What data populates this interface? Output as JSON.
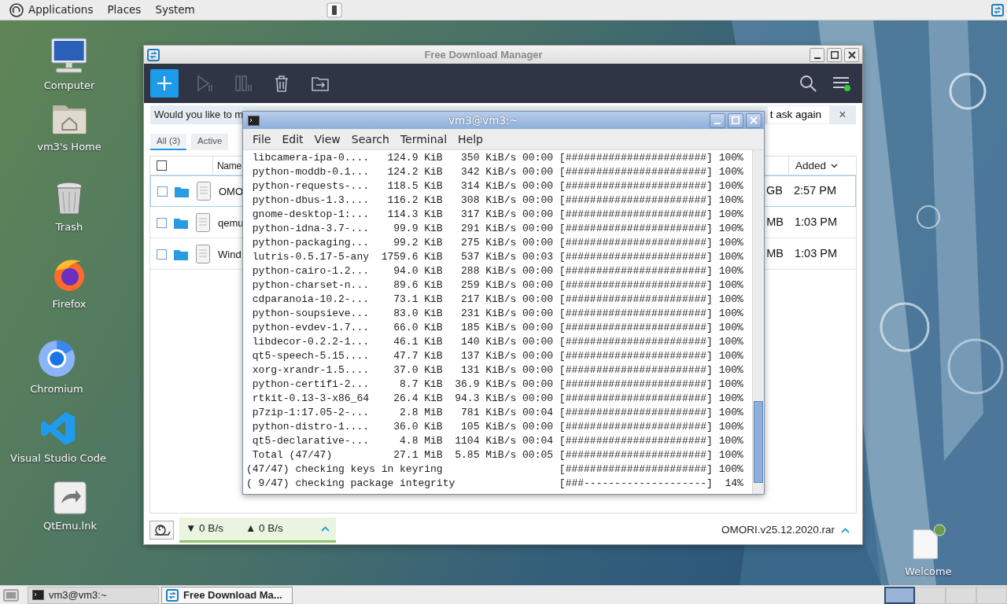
{
  "top_panel": {
    "menus": [
      "Applications",
      "Places",
      "System"
    ]
  },
  "desktop_icons": [
    {
      "label": "Computer",
      "kind": "computer"
    },
    {
      "label": "vm3's Home",
      "kind": "home"
    },
    {
      "label": "Trash",
      "kind": "trash"
    },
    {
      "label": "Firefox",
      "kind": "fox"
    },
    {
      "label": "Chromium",
      "kind": "chromium"
    },
    {
      "label": "Visual Studio Code",
      "kind": "code"
    },
    {
      "label": "QtEmu.lnk",
      "kind": "shortcut"
    },
    {
      "label": "Welcome",
      "kind": "document"
    }
  ],
  "download_window": {
    "title": "Free Download Manager",
    "toolbar": [
      {
        "kind": "add",
        "disabled": false
      },
      {
        "kind": "start",
        "disabled": true
      },
      {
        "kind": "stop",
        "disabled": true
      },
      {
        "kind": "delete",
        "disabled": false
      },
      {
        "kind": "move",
        "disabled": false
      },
      {
        "kind": "search",
        "disabled": false
      },
      {
        "kind": "menu",
        "disabled": false
      }
    ],
    "notice": {
      "text": "Would you like to m",
      "button": "t ask again",
      "close": "×"
    },
    "filters": [
      {
        "label": "All (3)",
        "selected": true
      },
      {
        "label": "Active",
        "selected": false
      }
    ],
    "select_all": {
      "checked": false
    },
    "columns": [
      {
        "label": "Name",
        "sorted": false
      },
      {
        "label": "Added",
        "sorted": true
      }
    ],
    "rows": [
      {
        "name": "OMO",
        "size": "GB",
        "added": "2:57 PM",
        "checked": false,
        "selected": true
      },
      {
        "name": "qemu",
        "size": "MB",
        "added": "1:03 PM",
        "checked": false,
        "selected": false
      },
      {
        "name": "Wind",
        "size": "MB",
        "added": "1:03 PM",
        "checked": false,
        "selected": false
      }
    ],
    "status": {
      "download": "▼ 0 B/s",
      "upload": "▲ 0 B/s",
      "file": "OMORI.v25.12.2020.rar"
    }
  },
  "terminal": {
    "title": "vm3@vm3:~",
    "menu": [
      "File",
      "Edit",
      "View",
      "Search",
      "Terminal",
      "Help"
    ],
    "lines": [
      " libcamera-ipa-0....   124.9 KiB   350 KiB/s 00:00 [#######################] 100%",
      " python-moddb-0.1...   124.2 KiB   342 KiB/s 00:00 [#######################] 100%",
      " python-requests-...   118.5 KiB   314 KiB/s 00:00 [#######################] 100%",
      " python-dbus-1.3....   116.2 KiB   308 KiB/s 00:00 [#######################] 100%",
      " gnome-desktop-1:...   114.3 KiB   317 KiB/s 00:00 [#######################] 100%",
      " python-idna-3.7-...    99.9 KiB   291 KiB/s 00:00 [#######################] 100%",
      " python-packaging...    99.2 KiB   275 KiB/s 00:00 [#######################] 100%",
      " lutris-0.5.17-5-any  1759.6 KiB   537 KiB/s 00:03 [#######################] 100%",
      " python-cairo-1.2...    94.0 KiB   288 KiB/s 00:00 [#######################] 100%",
      " python-charset-n...    89.6 KiB   259 KiB/s 00:00 [#######################] 100%",
      " cdparanoia-10.2-...    73.1 KiB   217 KiB/s 00:00 [#######################] 100%",
      " python-soupsieve...    83.0 KiB   231 KiB/s 00:00 [#######################] 100%",
      " python-evdev-1.7...    66.0 KiB   185 KiB/s 00:00 [#######################] 100%",
      " libdecor-0.2.2-1...    46.1 KiB   140 KiB/s 00:00 [#######################] 100%",
      " qt5-speech-5.15....    47.7 KiB   137 KiB/s 00:00 [#######################] 100%",
      " xorg-xrandr-1.5....    37.0 KiB   131 KiB/s 00:00 [#######################] 100%",
      " python-certifi-2...     8.7 KiB  36.9 KiB/s 00:00 [#######################] 100%",
      " rtkit-0.13-3-x86_64    26.4 KiB  94.3 KiB/s 00:00 [#######################] 100%",
      " p7zip-1:17.05-2-...     2.8 MiB   781 KiB/s 00:04 [#######################] 100%",
      " python-distro-1....    36.0 KiB   105 KiB/s 00:00 [#######################] 100%",
      " qt5-declarative-...     4.8 MiB  1104 KiB/s 00:04 [#######################] 100%",
      " Total (47/47)          27.1 MiB  5.85 MiB/s 00:05 [#######################] 100%",
      "(47/47) checking keys in keyring                   [#######################] 100%",
      "( 9/47) checking package integrity                 [###--------------------]  14%"
    ]
  },
  "taskbar": {
    "tasks": [
      {
        "label": "vm3@vm3:~",
        "kind": "terminal",
        "selected": false
      },
      {
        "label": "Free Download Ma...",
        "kind": "downloader",
        "selected": true
      }
    ],
    "workspaces": [
      {
        "selected": true
      },
      {
        "selected": false
      },
      {
        "selected": false
      },
      {
        "selected": false
      }
    ]
  }
}
